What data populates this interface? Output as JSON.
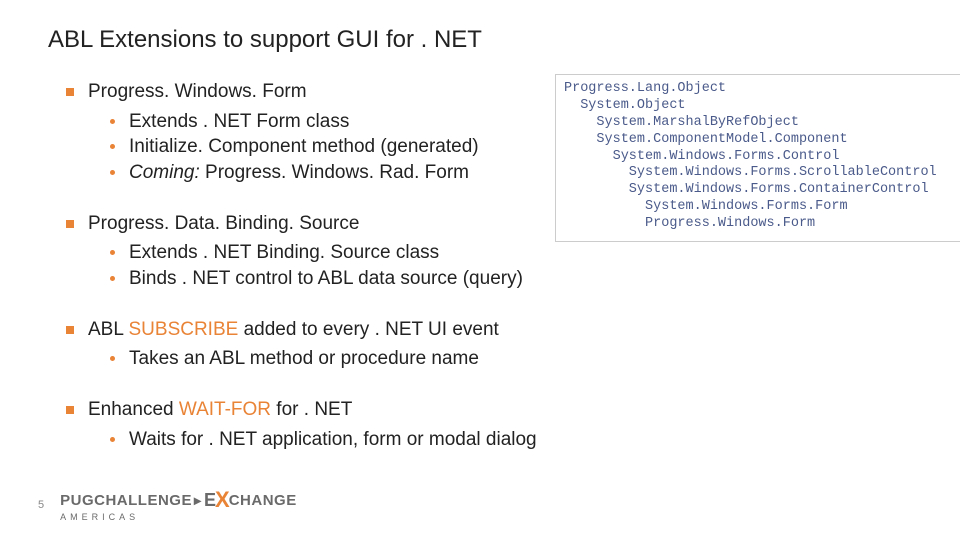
{
  "title": "ABL Extensions to support GUI for . NET",
  "bullets": [
    {
      "text": "Progress. Windows. Form",
      "sub": [
        {
          "text": "Extends . NET Form class"
        },
        {
          "text": "Initialize. Component method (generated)"
        },
        {
          "prefix": "Coming:",
          "text": " Progress. Windows. Rad. Form"
        }
      ]
    },
    {
      "text": "Progress. Data. Binding. Source",
      "sub": [
        {
          "text": "Extends . NET Binding. Source class"
        },
        {
          "text": "Binds . NET control to ABL data source (query)"
        }
      ]
    },
    {
      "pre": "ABL ",
      "highlight": "SUBSCRIBE",
      "post": " added to every . NET UI event",
      "sub": [
        {
          "text": "Takes an ABL method or procedure name"
        }
      ]
    },
    {
      "pre": "Enhanced ",
      "highlight": "WAIT-FOR",
      "post": " for . NET",
      "sub": [
        {
          "text": "Waits for . NET application, form or modal dialog"
        }
      ]
    }
  ],
  "tree": [
    "Progress.Lang.Object",
    "  System.Object",
    "    System.MarshalByRefObject",
    "    System.ComponentModel.Component",
    "      System.Windows.Forms.Control",
    "        System.Windows.Forms.ScrollableControl",
    "        System.Windows.Forms.ContainerControl",
    "          System.Windows.Forms.Form",
    "          Progress.Windows.Form"
  ],
  "page_number": "5",
  "logo": {
    "pug": "PUG",
    "challenge": "CHALLENGE",
    "e": "E",
    "x": "X",
    "change": "CHANGE",
    "sub": "AMERICAS"
  }
}
